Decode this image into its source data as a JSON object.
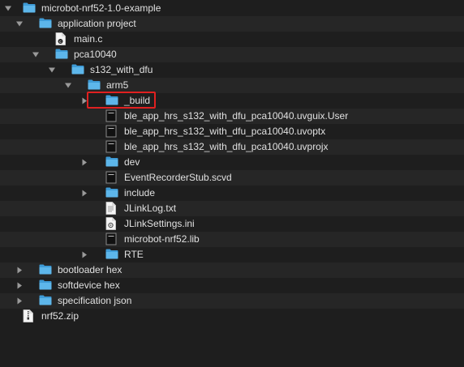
{
  "accent": "#4aa8e0",
  "highlight_color": "#e02020",
  "items": [
    {
      "label": "microbot-nrf52-1.0-example",
      "type": "folder",
      "icon": "folder-icon",
      "state": "expanded"
    },
    {
      "label": "application project",
      "type": "folder",
      "icon": "folder-icon",
      "state": "expanded"
    },
    {
      "label": "main.c",
      "type": "file",
      "icon": "c-source-file-icon"
    },
    {
      "label": "pca10040",
      "type": "folder",
      "icon": "folder-icon",
      "state": "expanded"
    },
    {
      "label": "s132_with_dfu",
      "type": "folder",
      "icon": "folder-icon",
      "state": "expanded"
    },
    {
      "label": "arm5",
      "type": "folder",
      "icon": "folder-icon",
      "state": "expanded"
    },
    {
      "label": "_build",
      "type": "folder",
      "icon": "folder-icon",
      "state": "collapsed",
      "highlighted": true
    },
    {
      "label": "ble_app_hrs_s132_with_dfu_pca10040.uvguix.User",
      "type": "file",
      "icon": "document-file-icon"
    },
    {
      "label": "ble_app_hrs_s132_with_dfu_pca10040.uvoptx",
      "type": "file",
      "icon": "document-file-icon"
    },
    {
      "label": "ble_app_hrs_s132_with_dfu_pca10040.uvprojx",
      "type": "file",
      "icon": "document-file-icon"
    },
    {
      "label": "dev",
      "type": "folder",
      "icon": "folder-icon",
      "state": "collapsed"
    },
    {
      "label": "EventRecorderStub.scvd",
      "type": "file",
      "icon": "document-file-icon"
    },
    {
      "label": "include",
      "type": "folder",
      "icon": "folder-icon",
      "state": "collapsed"
    },
    {
      "label": "JLinkLog.txt",
      "type": "file",
      "icon": "text-file-icon"
    },
    {
      "label": "JLinkSettings.ini",
      "type": "file",
      "icon": "settings-file-icon"
    },
    {
      "label": "microbot-nrf52.lib",
      "type": "file",
      "icon": "document-file-icon"
    },
    {
      "label": "RTE",
      "type": "folder",
      "icon": "folder-icon",
      "state": "collapsed"
    },
    {
      "label": "bootloader hex",
      "type": "folder",
      "icon": "folder-icon",
      "state": "collapsed"
    },
    {
      "label": "softdevice hex",
      "type": "folder",
      "icon": "folder-icon",
      "state": "collapsed"
    },
    {
      "label": "specification json",
      "type": "folder",
      "icon": "folder-icon",
      "state": "collapsed"
    },
    {
      "label": "nrf52.zip",
      "type": "file",
      "icon": "zip-file-icon"
    }
  ]
}
